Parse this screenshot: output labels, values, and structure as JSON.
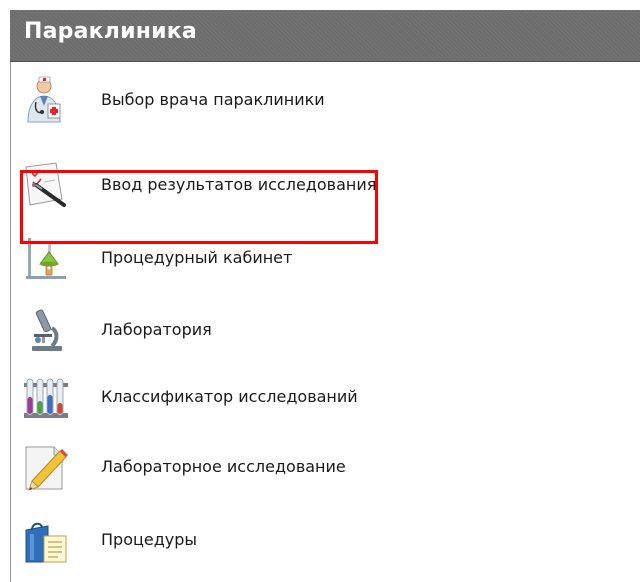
{
  "panel": {
    "title": "Параклиника",
    "header_color": "#6d6d6d",
    "highlight_color": "#ff0000",
    "items": [
      {
        "label": "Выбор врача параклиники",
        "icon": "doctor-icon"
      },
      {
        "label": "Ввод результатов исследования",
        "icon": "test-results-icon"
      },
      {
        "label": "Процедурный кабинет",
        "icon": "procedure-room-icon",
        "highlighted": true
      },
      {
        "label": "Лаборатория",
        "icon": "microscope-icon"
      },
      {
        "label": "Классификатор исследований",
        "icon": "test-tubes-icon"
      },
      {
        "label": "Лабораторное исследование",
        "icon": "pencil-document-icon"
      },
      {
        "label": "Процедуры",
        "icon": "procedures-icon"
      }
    ]
  }
}
